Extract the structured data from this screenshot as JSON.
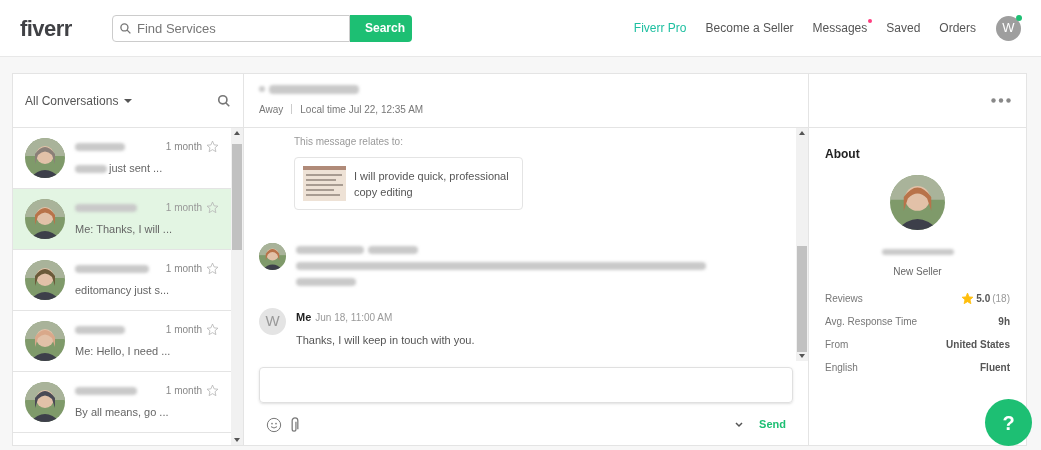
{
  "header": {
    "logo": "fiverr",
    "search": {
      "placeholder": "Find Services",
      "button": "Search"
    },
    "nav": [
      {
        "label": "Fiverr Pro",
        "kind": "pro",
        "badge": false
      },
      {
        "label": "Become a Seller",
        "kind": "link",
        "badge": false
      },
      {
        "label": "Messages",
        "kind": "link",
        "badge": true
      },
      {
        "label": "Saved",
        "kind": "link",
        "badge": false
      },
      {
        "label": "Orders",
        "kind": "link",
        "badge": false
      }
    ],
    "avatar": {
      "initial": "W",
      "online": true
    }
  },
  "sidebar": {
    "filter": "All Conversations",
    "conversations": [
      {
        "preview": "just sent ...",
        "redacted_prefix": true,
        "time": "1 month",
        "starred": false,
        "selected": false
      },
      {
        "preview": "Me: Thanks, I will ...",
        "redacted_prefix": false,
        "time": "1 month",
        "starred": false,
        "selected": true
      },
      {
        "preview": "editomancy just s...",
        "redacted_prefix": false,
        "time": "1 month",
        "starred": false,
        "selected": false
      },
      {
        "preview": "Me: Hello, I need ...",
        "redacted_prefix": false,
        "time": "1 month",
        "starred": false,
        "selected": false
      },
      {
        "preview": "By all means, go ...",
        "redacted_prefix": false,
        "time": "1 month",
        "starred": false,
        "selected": false
      }
    ]
  },
  "conversation": {
    "status": "Away",
    "local_time": "Local time Jul 22, 12:35 AM",
    "relates_label": "This message relates to:",
    "gig_title": "I will provide quick, professional copy editing",
    "messages": [
      {
        "kind": "redacted"
      },
      {
        "kind": "text",
        "sender": "Me",
        "time": "Jun 18, 11:00 AM",
        "initial": "W",
        "text": "Thanks, I will keep in touch with you."
      }
    ],
    "send": "Send"
  },
  "about": {
    "title": "About",
    "level": "New Seller",
    "stats": [
      {
        "kind": "rating",
        "label": "Reviews",
        "value": "5.0",
        "count": "(18)"
      },
      {
        "kind": "plain",
        "label": "Avg. Response Time",
        "value": "9h"
      },
      {
        "kind": "plain",
        "label": "From",
        "value": "United States"
      },
      {
        "kind": "plain",
        "label": "English",
        "value": "Fluent"
      }
    ]
  },
  "help": "?"
}
